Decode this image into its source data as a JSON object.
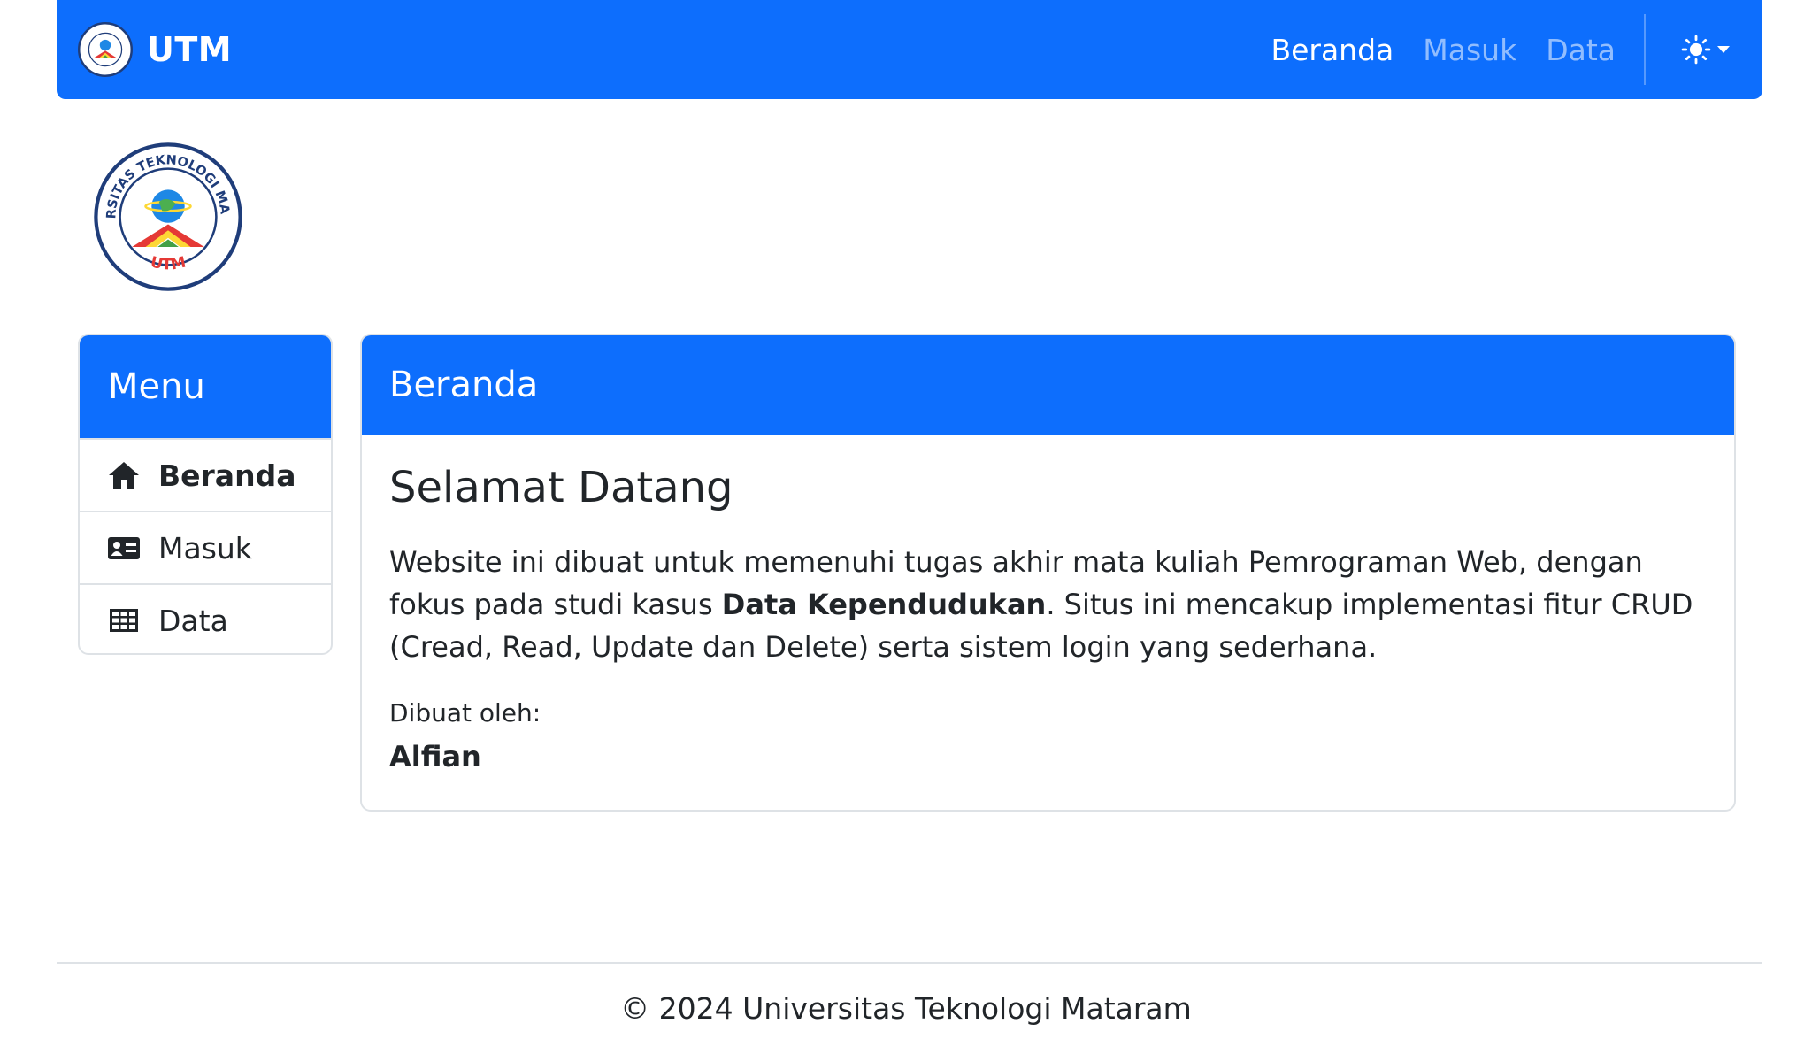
{
  "navbar": {
    "brand": "UTM",
    "links": [
      {
        "label": "Beranda",
        "active": true
      },
      {
        "label": "Masuk",
        "active": false
      },
      {
        "label": "Data",
        "active": false
      }
    ],
    "theme_icon": "sun-icon"
  },
  "logo": {
    "top_text": "UNIVERSITAS TEKNOLOGI MATARAM",
    "bottom_text": "UTM"
  },
  "sidebar": {
    "title": "Menu",
    "items": [
      {
        "label": "Beranda",
        "icon": "home-icon",
        "active": true
      },
      {
        "label": "Masuk",
        "icon": "id-card-icon",
        "active": false
      },
      {
        "label": "Data",
        "icon": "table-icon",
        "active": false
      }
    ]
  },
  "main": {
    "header": "Beranda",
    "title": "Selamat Datang",
    "description_part1": "Website ini dibuat untuk memenuhi tugas akhir mata kuliah Pemrograman Web, dengan fokus pada studi kasus ",
    "description_bold": "Data Kependudukan",
    "description_part2": ". Situs ini mencakup implementasi fitur CRUD (Cread, Read, Update dan Delete) serta sistem login yang sederhana.",
    "credit_label": "Dibuat oleh:",
    "credit_name": "Alfian"
  },
  "footer": {
    "text": "© 2024 Universitas Teknologi Mataram"
  },
  "colors": {
    "primary": "#0d6efd",
    "border": "#dee2e6",
    "text": "#212529"
  }
}
